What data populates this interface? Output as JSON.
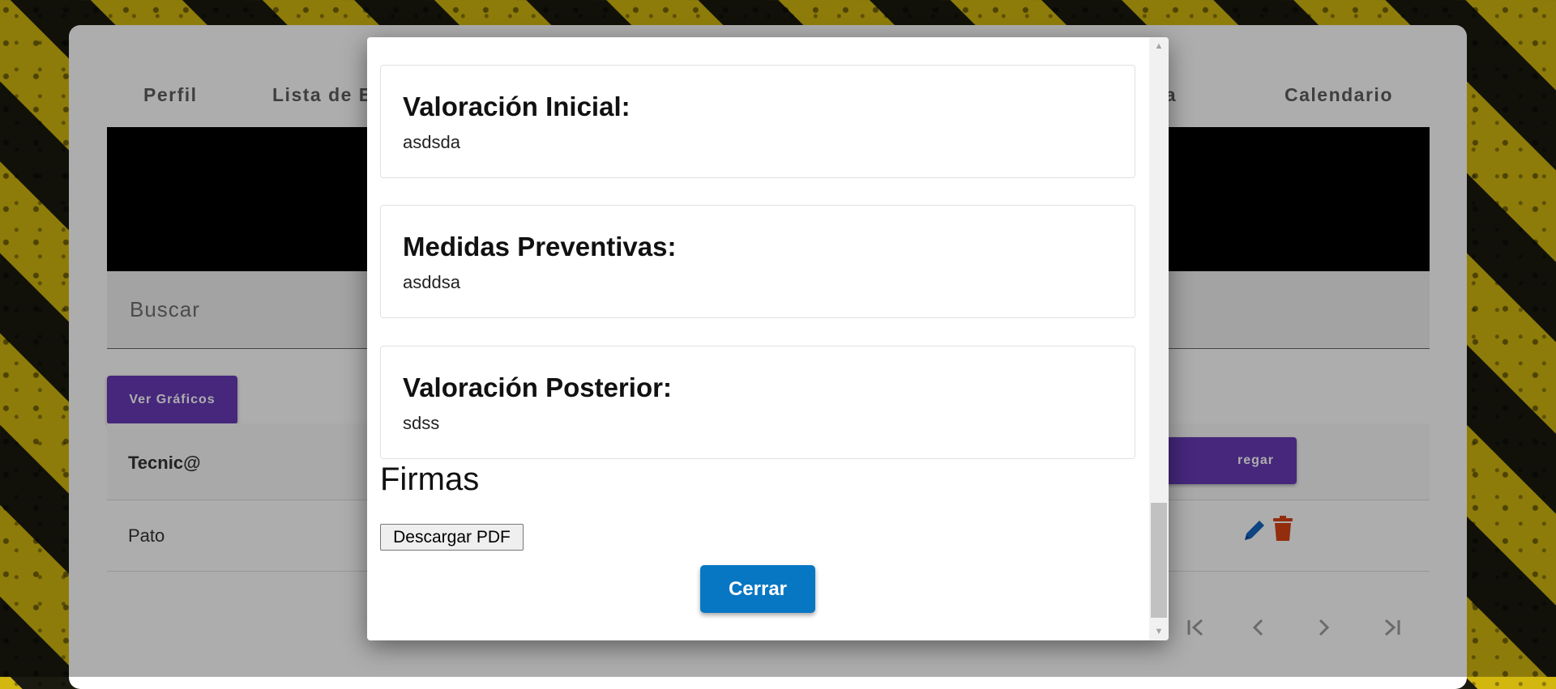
{
  "tabs": [
    "Perfil",
    "Lista de E",
    "ncia",
    "Calendario"
  ],
  "search": {
    "placeholder": "Buscar"
  },
  "buttons": {
    "charts": "Ver Gráficos",
    "add_partial": "regar"
  },
  "table": {
    "header_col1": "Tecnic@",
    "row1_col1": "Pato"
  },
  "icons": {
    "edit": "edit-pencil-icon",
    "delete": "trash-icon",
    "first": "first-page-icon",
    "prev": "prev-page-icon",
    "next": "next-page-icon",
    "last": "last-page-icon"
  },
  "colors": {
    "purple": "#673ab7",
    "blue": "#0877c3",
    "delete_red": "#d84315",
    "edit_blue": "#1565c0"
  },
  "modal": {
    "fields": [
      {
        "label": "Valoración Inicial:",
        "value": "asdsda"
      },
      {
        "label": "Medidas Preventivas:",
        "value": "asddsa"
      },
      {
        "label": "Valoración Posterior:",
        "value": "sdss"
      }
    ],
    "section_title": "Firmas",
    "pdf_button": "Descargar PDF",
    "close_button": "Cerrar"
  }
}
